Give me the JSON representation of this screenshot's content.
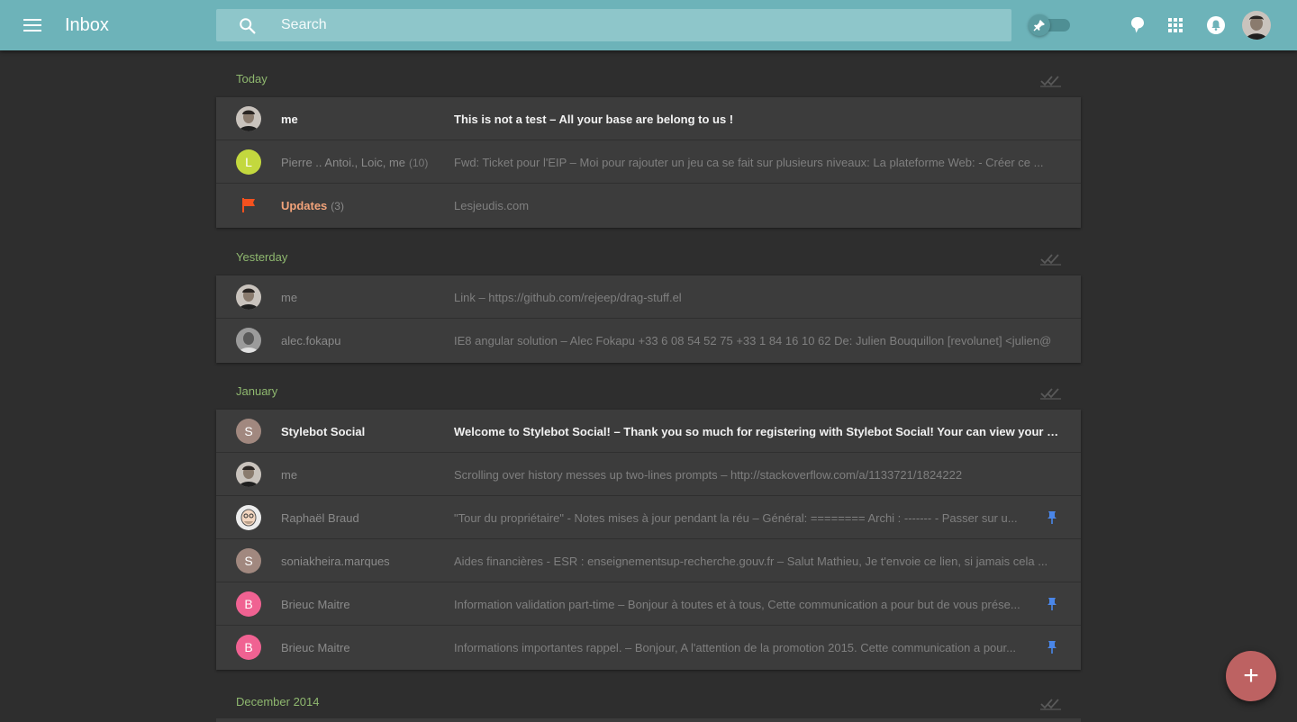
{
  "app": {
    "title": "Inbox"
  },
  "search": {
    "placeholder": "Search",
    "value": ""
  },
  "header_icons": [
    "pin-toggle-icon",
    "chat-bubble-icon",
    "apps-grid-icon",
    "notifications-icon",
    "account-avatar"
  ],
  "colors": {
    "topbar": "#6db3b9",
    "background": "#2e2e2e",
    "row": "#3c3c3c",
    "section_label": "#8fb86f",
    "updates": "#f2a37a",
    "pin": "#4a86e8",
    "fab": "#bd6262",
    "avatar_L": "#c3d83e",
    "avatar_S": "#a1887f",
    "avatar_B": "#f06292"
  },
  "sections": [
    {
      "label": "Today",
      "rows": [
        {
          "avatar": "photo-me",
          "sender": "me",
          "count": "",
          "subject": "This is not a test – All your base are belong to us !",
          "unread": true,
          "pinned": false
        },
        {
          "avatar": "L",
          "sender": "Pierre .. Antoi., Loic, me",
          "count": "(10)",
          "subject": "Fwd: Ticket pour l'EIP – Moi pour rajouter un jeu ca se fait sur plusieurs niveaux: La plateforme Web: - Créer ce ...",
          "unread": false,
          "pinned": false
        },
        {
          "avatar": "flag",
          "sender": "Updates",
          "count": "(3)",
          "subject": "Lesjeudis.com",
          "unread": false,
          "pinned": false,
          "type": "updates"
        }
      ]
    },
    {
      "label": "Yesterday",
      "rows": [
        {
          "avatar": "photo-me",
          "sender": "me",
          "count": "",
          "subject": "Link – https://github.com/rejeep/drag-stuff.el",
          "unread": false,
          "pinned": false
        },
        {
          "avatar": "photo-alec",
          "sender": "alec.fokapu",
          "count": "",
          "subject": "IE8 angular solution – Alec Fokapu +33 6 08 54 52 75 +33 1 84 16 10 62 De: Julien Bouquillon [revolunet] <julien@",
          "unread": false,
          "pinned": false
        }
      ]
    },
    {
      "label": "January",
      "rows": [
        {
          "avatar": "S",
          "sender": "Stylebot Social",
          "count": "",
          "subject": "Welcome to Stylebot Social! – Thank you so much for registering with Stylebot Social! Your can view your styles...",
          "unread": true,
          "pinned": false
        },
        {
          "avatar": "photo-me",
          "sender": "me",
          "count": "",
          "subject": "Scrolling over history messes up two-lines prompts – http://stackoverflow.com/a/1133721/1824222",
          "unread": false,
          "pinned": false
        },
        {
          "avatar": "photo-raphael",
          "sender": "Raphaël Braud",
          "count": "",
          "subject": "\"Tour du propriétaire\" - Notes mises à jour pendant la réu – Général: ======== Archi : ------- - Passer sur u...",
          "unread": false,
          "pinned": true
        },
        {
          "avatar": "S",
          "sender": "soniakheira.marques",
          "count": "",
          "subject": "Aides financières - ESR : enseignementsup-recherche.gouv.fr – Salut Mathieu, Je t'envoie ce lien, si jamais cela ...",
          "unread": false,
          "pinned": false
        },
        {
          "avatar": "B",
          "sender": "Brieuc Maitre",
          "count": "",
          "subject": "Information validation part-time – Bonjour à toutes et à tous, Cette communication a pour but de vous prése...",
          "unread": false,
          "pinned": true
        },
        {
          "avatar": "B",
          "sender": "Brieuc Maitre",
          "count": "",
          "subject": "Informations importantes rappel. – Bonjour, A l'attention de la promotion 2015. Cette communication a pour...",
          "unread": false,
          "pinned": true
        }
      ]
    },
    {
      "label": "December 2014",
      "rows": []
    }
  ],
  "fab": {
    "label": "+"
  }
}
